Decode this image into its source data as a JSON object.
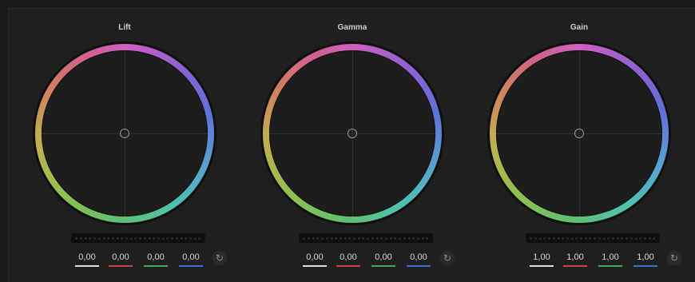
{
  "colors": {
    "master_underline": "#e0e0e0",
    "red_underline": "#d04040",
    "green_underline": "#3fae4f",
    "blue_underline": "#3a6fd8"
  },
  "wheels": [
    {
      "title": "Lift",
      "values": {
        "master": "0,00",
        "red": "0,00",
        "green": "0,00",
        "blue": "0,00"
      }
    },
    {
      "title": "Gamma",
      "values": {
        "master": "0,00",
        "red": "0,00",
        "green": "0,00",
        "blue": "0,00"
      }
    },
    {
      "title": "Gain",
      "values": {
        "master": "1,00",
        "red": "1,00",
        "green": "1,00",
        "blue": "1,00"
      }
    }
  ],
  "icons": {
    "reset": "reset-icon",
    "handle": "center-handle-icon"
  }
}
